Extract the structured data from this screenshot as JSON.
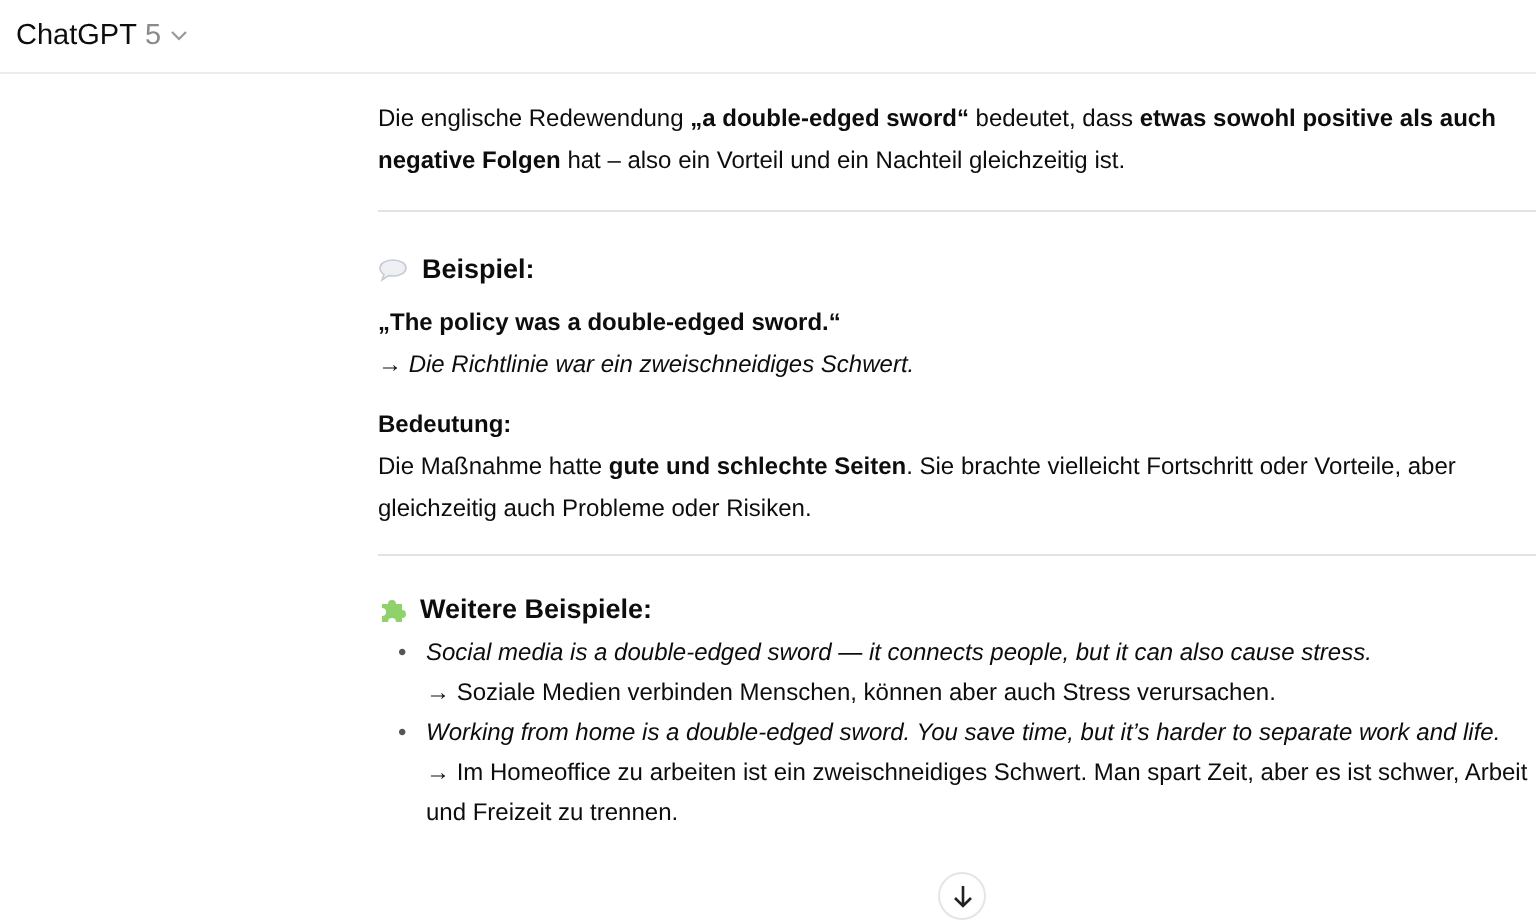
{
  "header": {
    "title": "ChatGPT",
    "version": "5"
  },
  "intro": "Die englische Redewendung **„a double-edged sword“** bedeutet, dass **etwas sowohl positive als auch negative Folgen** hat – also ein Vorteil und ein Nachteil gleichzeitig ist.",
  "example": {
    "heading": "Beispiel:",
    "quote": "„The policy was a double-edged sword.“",
    "translation": "→ Die Richtlinie war ein zweischneidiges Schwert.",
    "meaning_label": "Bedeutung:",
    "meaning": "Die Maßnahme hatte **gute und schlechte Seiten**. Sie brachte vielleicht Fortschritt oder Vorteile, aber gleichzeitig auch Probleme oder Risiken."
  },
  "more_examples": {
    "heading": "Weitere Beispiele:",
    "items": [
      {
        "bullet": "•",
        "english": "Social media is a double-edged sword — it connects people, but it can also cause stress.",
        "german": "→ Soziale Medien verbinden Menschen, können aber auch Stress verursachen."
      },
      {
        "bullet": "•",
        "english": "Working from home is a double-edged sword. You save time, but it’s harder to separate work and life.",
        "german": "→ Im Homeoffice zu arbeiten ist ein zweischneidiges Schwert. Man spart Zeit, aber es ist schwer, Arbeit und Freizeit zu trennen."
      }
    ]
  }
}
